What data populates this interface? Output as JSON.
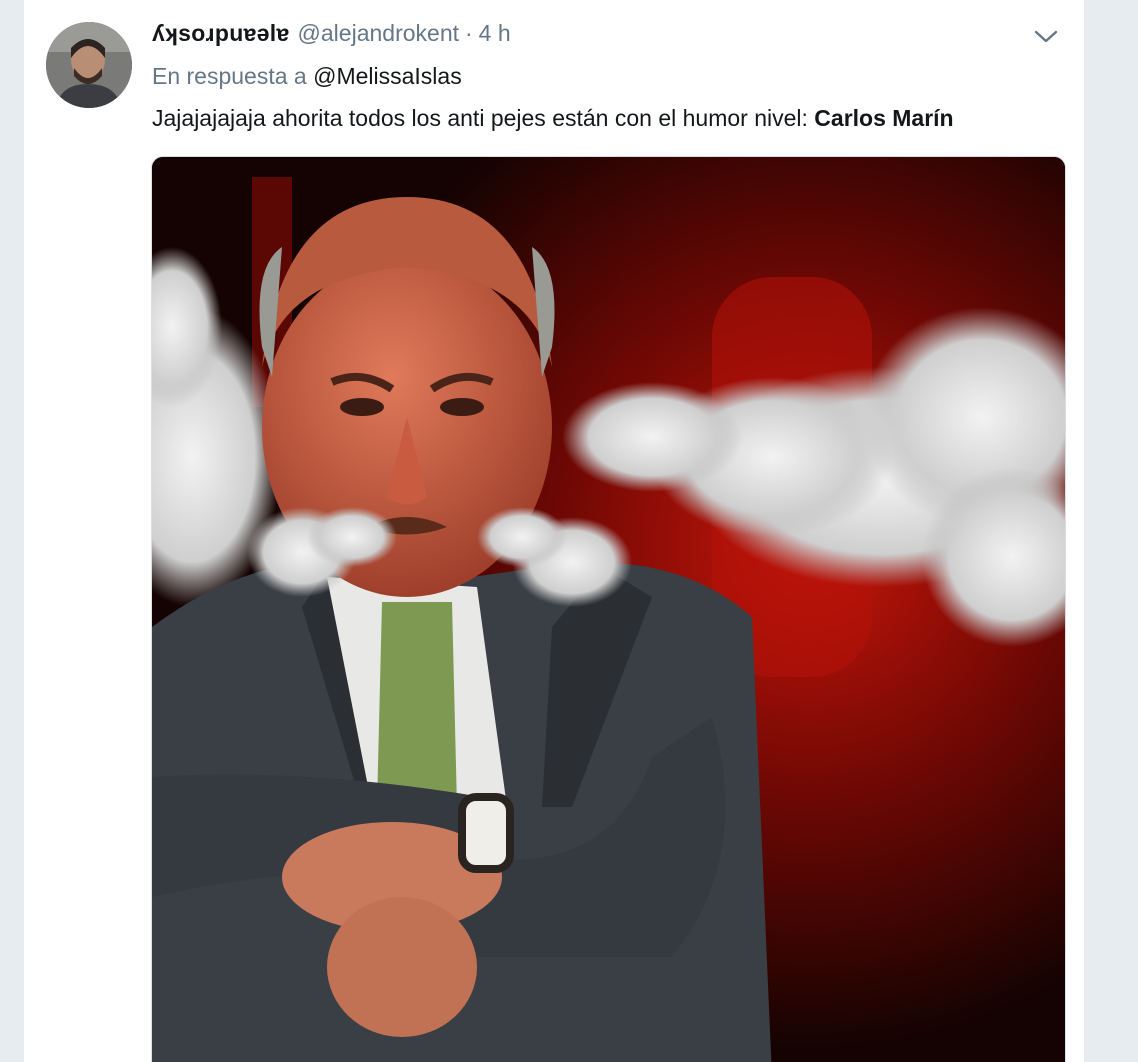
{
  "tweet": {
    "display_name": "ʎʞsoɹpuɐǝlɐ",
    "handle": "@alejandrokent",
    "separator": "·",
    "time": "4 h",
    "reply_prefix": "En respuesta a",
    "reply_handle": "@MelissaIslas",
    "text": "Jajajajajaja ahorita todos los anti pejes están con el humor nivel:",
    "text_bold": "Carlos Marín",
    "avatar_icon": "user-avatar",
    "caret_icon": "chevron-down-icon"
  },
  "colors": {
    "background": "#e6ecf0",
    "card": "#ffffff",
    "primary_text": "#14171a",
    "secondary_text": "#657786"
  }
}
